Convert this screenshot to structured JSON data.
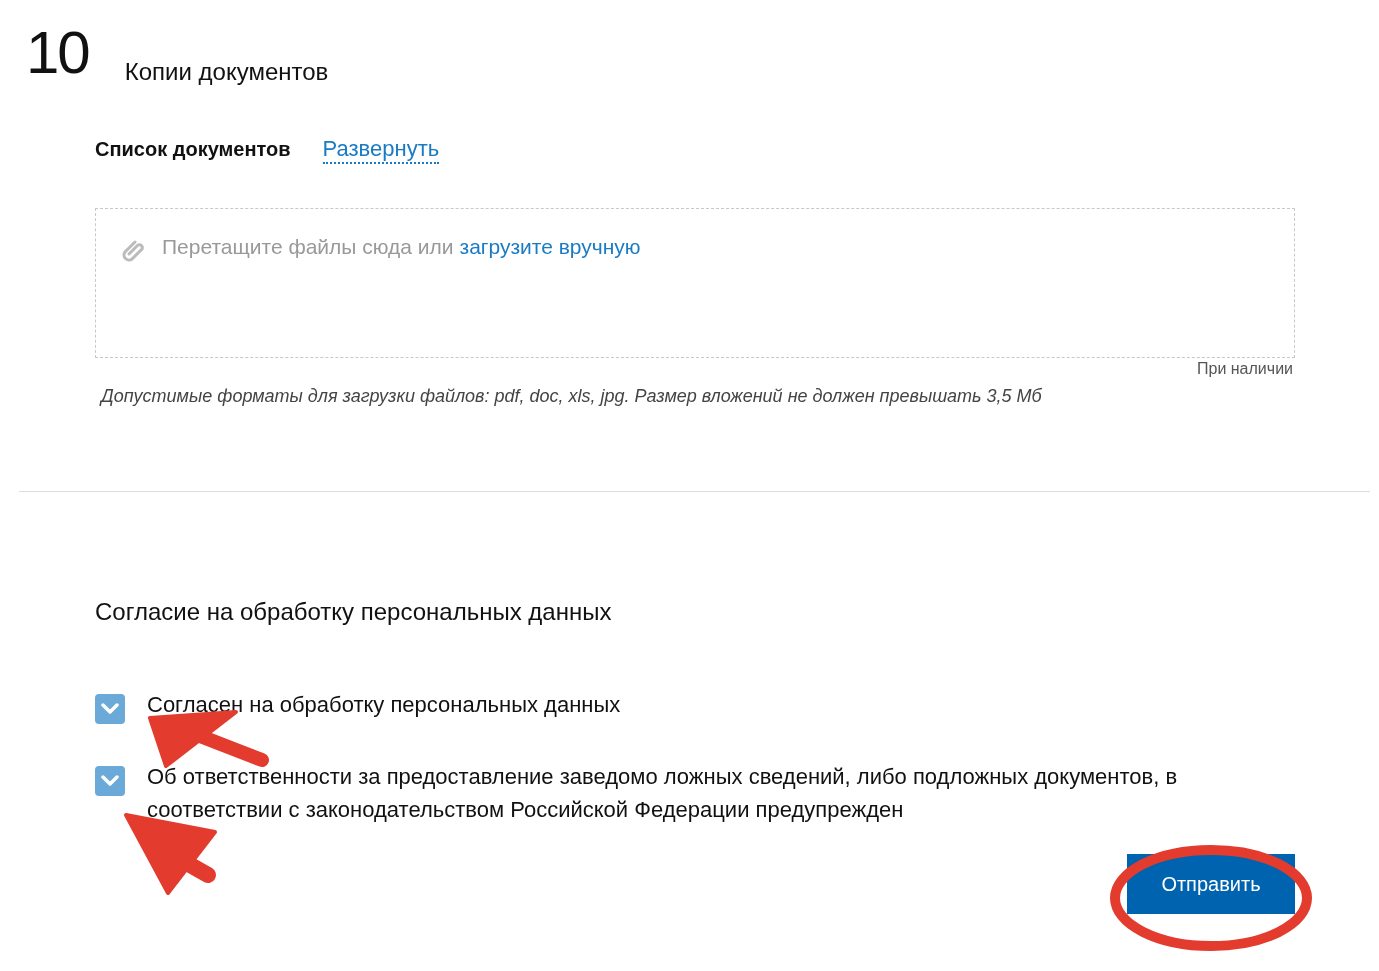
{
  "section": {
    "number": "10",
    "title": "Копии документов",
    "list_label": "Список документов",
    "expand_link": "Развернуть",
    "dropzone": {
      "prompt": "Перетащите файлы сюда или",
      "upload_link": "загрузите вручную"
    },
    "optional_note": "При наличии",
    "hint": "Допустимые форматы для загрузки файлов: pdf, doc, xls, jpg. Размер вложений не должен превышать 3,5 Мб"
  },
  "consent": {
    "title": "Согласие на обработку персональных данных",
    "items": [
      {
        "label": "Согласен на обработку персональных данных",
        "checked": true
      },
      {
        "label": "Об ответственности за предоставление заведомо ложных сведений, либо подложных документов, в соответствии с законодательством Российской Федерации предупрежден",
        "checked": true
      }
    ]
  },
  "submit_button": "Отправить"
}
